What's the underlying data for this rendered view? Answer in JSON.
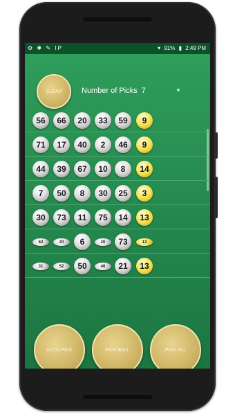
{
  "status_bar": {
    "left_icons": [
      "gear-icon",
      "bug-icon",
      "wrench-icon",
      "ip-icon"
    ],
    "left_text": "⚙ ✱ ✎ IP",
    "wifi": "▾",
    "battery": "91%",
    "time": "2:49 PM"
  },
  "controls": {
    "clear_label": "CLEAR",
    "picks_label": "Number of Picks",
    "picks_value": "7",
    "dropdown_arrow": "▼"
  },
  "rows": [
    {
      "numbers": [
        "56",
        "66",
        "20",
        "33",
        "59"
      ],
      "bonus": "9"
    },
    {
      "numbers": [
        "71",
        "17",
        "40",
        "2",
        "46"
      ],
      "bonus": "9"
    },
    {
      "numbers": [
        "44",
        "39",
        "67",
        "10",
        "8"
      ],
      "bonus": "14"
    },
    {
      "numbers": [
        "7",
        "50",
        "8",
        "30",
        "25"
      ],
      "bonus": "3"
    },
    {
      "numbers": [
        "30",
        "73",
        "11",
        "75",
        "14"
      ],
      "bonus": "13"
    },
    {
      "numbers": [
        "62",
        "20",
        "6",
        "20",
        "73"
      ],
      "bonus": "13"
    },
    {
      "numbers": [
        "31",
        "52",
        "50",
        "46",
        "21"
      ],
      "bonus": "13"
    }
  ],
  "buttons": {
    "auto_pick": "AUTO PICK",
    "pick_ball": "PICK BALL",
    "pick_all": "PICK ALL"
  },
  "colors": {
    "felt_green": "#239356",
    "status_bar": "#0b5129",
    "gold": "#d1b768",
    "bonus_yellow": "#f2e04a"
  }
}
